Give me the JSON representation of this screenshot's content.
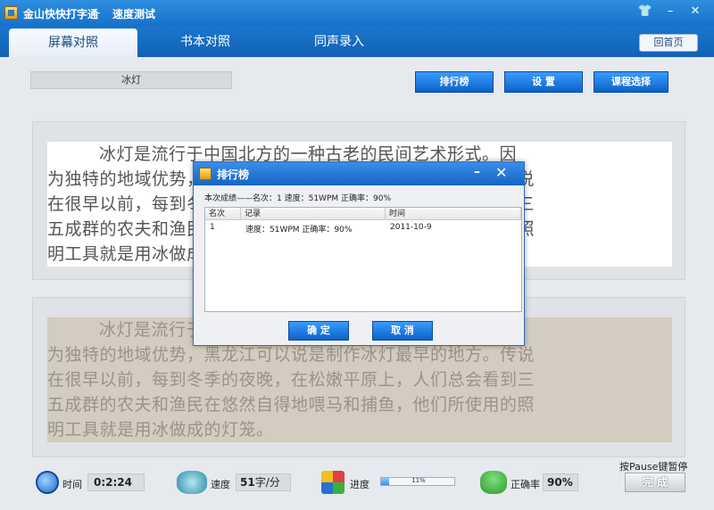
{
  "titlebar": {
    "app_name": "金山快快打字通",
    "separator": "-",
    "mode": "速度测试"
  },
  "tabs": [
    {
      "label": "屏幕对照",
      "active": true
    },
    {
      "label": "书本对照",
      "active": false
    },
    {
      "label": "同声录入",
      "active": false
    }
  ],
  "home_button": "回首页",
  "lesson_title": "冰灯",
  "toolbar": {
    "rank": "排行榜",
    "settings": "设  置",
    "course": "课程选择"
  },
  "reference_text": [
    "冰灯是流行于中国北方的一种古老的民间艺术形式。因",
    "为独特的地域优势，黑龙江可以说是制作冰灯最早的地方。传说",
    "在很早以前，每到冬季的夜晚，在松嫩平原上，人们总会看到三",
    "五成群的农夫和渔民在悠然自得地喂马和捕鱼，他们所使用的照",
    "明工具就是用冰做成的灯笼。当时制作冰灯"
  ],
  "typed_text": [
    "冰灯是流行于中国北方的一种古老的民间艺术形式。因",
    "为独特的地域优势，黑龙江可以说是制作冰灯最早的地方。传说",
    "在很早以前，每到冬季的夜晚，在松嫩平原上，人们总会看到三",
    "五成群的农夫和渔民在悠然自得地喂马和捕鱼，他们所使用的照",
    "明工具就是用冰做成的灯笼。"
  ],
  "dialog": {
    "title": "排行榜",
    "summary": "本次成绩——名次：1   速度：51WPM   正确率：90%",
    "columns": [
      "名次",
      "记录",
      "时间"
    ],
    "rows": [
      {
        "rank": "1",
        "record": "速度：51WPM 正确率：90%",
        "time": "2011-10-9"
      }
    ],
    "ok": "确  定",
    "cancel": "取  消"
  },
  "status": {
    "time_label": "时间",
    "time_value": "0:2:24",
    "speed_label": "速度",
    "speed_value": "51",
    "speed_unit": "字/分",
    "progress_label": "进度",
    "progress_text": "11%",
    "progress_fraction": 0.11,
    "accuracy_label": "正确率",
    "accuracy_value": "90%",
    "pause_hint": "按Pause键暂停",
    "finish_button": "完  成"
  },
  "icons": {
    "clock": "clock-icon",
    "speed": "speed-icon",
    "progress": "progress-icon",
    "accuracy": "accuracy-icon"
  },
  "colors": {
    "title_bar": "#1670c8",
    "accent": "#1565c4"
  }
}
